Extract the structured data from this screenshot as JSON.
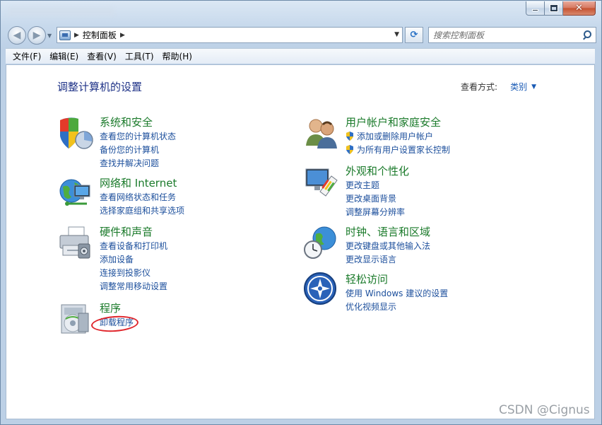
{
  "window": {
    "minimize_glyph": "—",
    "maximize_glyph": "□",
    "close_glyph": "✕"
  },
  "nav": {
    "back_icon": "back-arrow-icon",
    "forward_icon": "forward-arrow-icon",
    "address_segments": [
      "控制面板"
    ],
    "search_placeholder": "搜索控制面板"
  },
  "menubar": {
    "items": [
      "文件(F)",
      "编辑(E)",
      "查看(V)",
      "工具(T)",
      "帮助(H)"
    ]
  },
  "content": {
    "heading": "调整计算机的设置",
    "view_by_label": "查看方式:",
    "view_by_value": "类别"
  },
  "categories": {
    "system": {
      "title": "系统和安全",
      "links": [
        "查看您的计算机状态",
        "备份您的计算机",
        "查找并解决问题"
      ]
    },
    "network": {
      "title": "网络和 Internet",
      "links": [
        "查看网络状态和任务",
        "选择家庭组和共享选项"
      ]
    },
    "hardware": {
      "title": "硬件和声音",
      "links": [
        "查看设备和打印机",
        "添加设备",
        "连接到投影仪",
        "调整常用移动设置"
      ]
    },
    "programs": {
      "title": "程序",
      "links": [
        "卸载程序"
      ]
    },
    "users": {
      "title": "用户帐户和家庭安全",
      "links": [
        "添加或删除用户帐户",
        "为所有用户设置家长控制"
      ]
    },
    "appearance": {
      "title": "外观和个性化",
      "links": [
        "更改主题",
        "更改桌面背景",
        "调整屏幕分辨率"
      ]
    },
    "clock": {
      "title": "时钟、语言和区域",
      "links": [
        "更改键盘或其他输入法",
        "更改显示语言"
      ]
    },
    "access": {
      "title": "轻松访问",
      "links": [
        "使用 Windows 建议的设置",
        "优化视频显示"
      ]
    }
  },
  "watermark": "CSDN @Cignus",
  "colors": {
    "link": "#1c4f9c",
    "category_title": "#1a7a2a",
    "heading": "#1e3287",
    "highlight_circle": "#e0242a"
  }
}
